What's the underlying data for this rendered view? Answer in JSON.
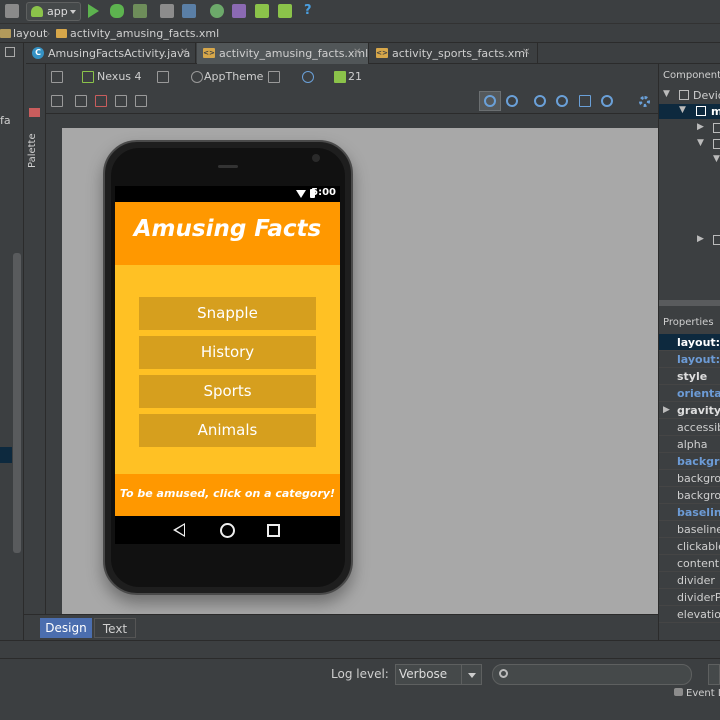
{
  "toolbar": {
    "run_config": "app",
    "icons": [
      "run-icon",
      "debug-icon",
      "attach-debugger-icon",
      "project-structure-icon",
      "sdk-manager-icon",
      "avd-manager-icon",
      "android-monitor-icon",
      "help-icon"
    ]
  },
  "breadcrumb": {
    "items": [
      "layout",
      "activity_amusing_facts.xml"
    ]
  },
  "editor_tabs": [
    {
      "label": "AmusingFactsActivity.java",
      "type": "java"
    },
    {
      "label": "activity_amusing_facts.xml",
      "type": "xml",
      "active": true
    },
    {
      "label": "activity_sports_facts.xml",
      "type": "xml"
    }
  ],
  "palette_label": "Palette",
  "design_toolbar": {
    "device": "Nexus 4",
    "theme": "AppTheme",
    "api": "21"
  },
  "left_strip": {
    "partial_label": "fa"
  },
  "device_preview": {
    "status_time": "5:00",
    "app_title": "Amusing Facts",
    "categories": [
      "Snapple",
      "History",
      "Sports",
      "Animals"
    ],
    "footer_text": "To be amused, click on a category!",
    "colors": {
      "header": "#ff9800",
      "body": "#ffc124",
      "button": "#d69f1e"
    }
  },
  "bottom_tabs": {
    "design": "Design",
    "text": "Text"
  },
  "component_tree": {
    "title": "Component",
    "root": "Devic",
    "selected": "m"
  },
  "properties": {
    "title": "Properties",
    "rows": [
      {
        "label": "layout:w",
        "style": "bold"
      },
      {
        "label": "layout:h",
        "style": "blue"
      },
      {
        "label": "style",
        "style": "bold"
      },
      {
        "label": "orientat",
        "style": "blue"
      },
      {
        "label": "gravity",
        "style": "bold",
        "expandable": true
      },
      {
        "label": "accessib",
        "style": "normal"
      },
      {
        "label": "alpha",
        "style": "normal"
      },
      {
        "label": "backgro",
        "style": "blue"
      },
      {
        "label": "backgro",
        "style": "normal"
      },
      {
        "label": "backgro",
        "style": "normal"
      },
      {
        "label": "baseline",
        "style": "blue"
      },
      {
        "label": "baseline.",
        "style": "normal"
      },
      {
        "label": "clickable",
        "style": "normal"
      },
      {
        "label": "contentD",
        "style": "normal"
      },
      {
        "label": "divider",
        "style": "normal"
      },
      {
        "label": "dividerPa",
        "style": "normal"
      },
      {
        "label": "elevation",
        "style": "normal"
      }
    ]
  },
  "log": {
    "label": "Log level:",
    "level": "Verbose",
    "event_log": "Event L"
  }
}
